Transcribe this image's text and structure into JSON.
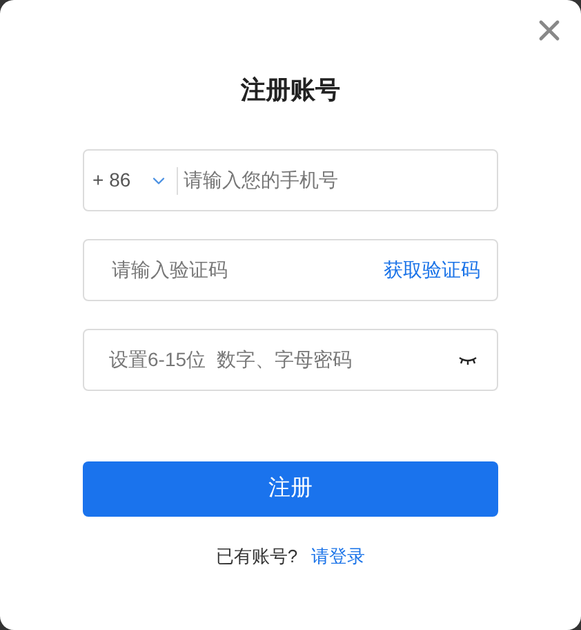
{
  "dialog": {
    "title": "注册账号"
  },
  "phone": {
    "country_code": "+ 86",
    "placeholder": "请输入您的手机号"
  },
  "code": {
    "placeholder": "请输入验证码",
    "action": "获取验证码"
  },
  "password": {
    "placeholder": "设置6-15位  数字、字母密码"
  },
  "submit": "注册",
  "footer": {
    "text": "已有账号?",
    "link": "请登录"
  }
}
